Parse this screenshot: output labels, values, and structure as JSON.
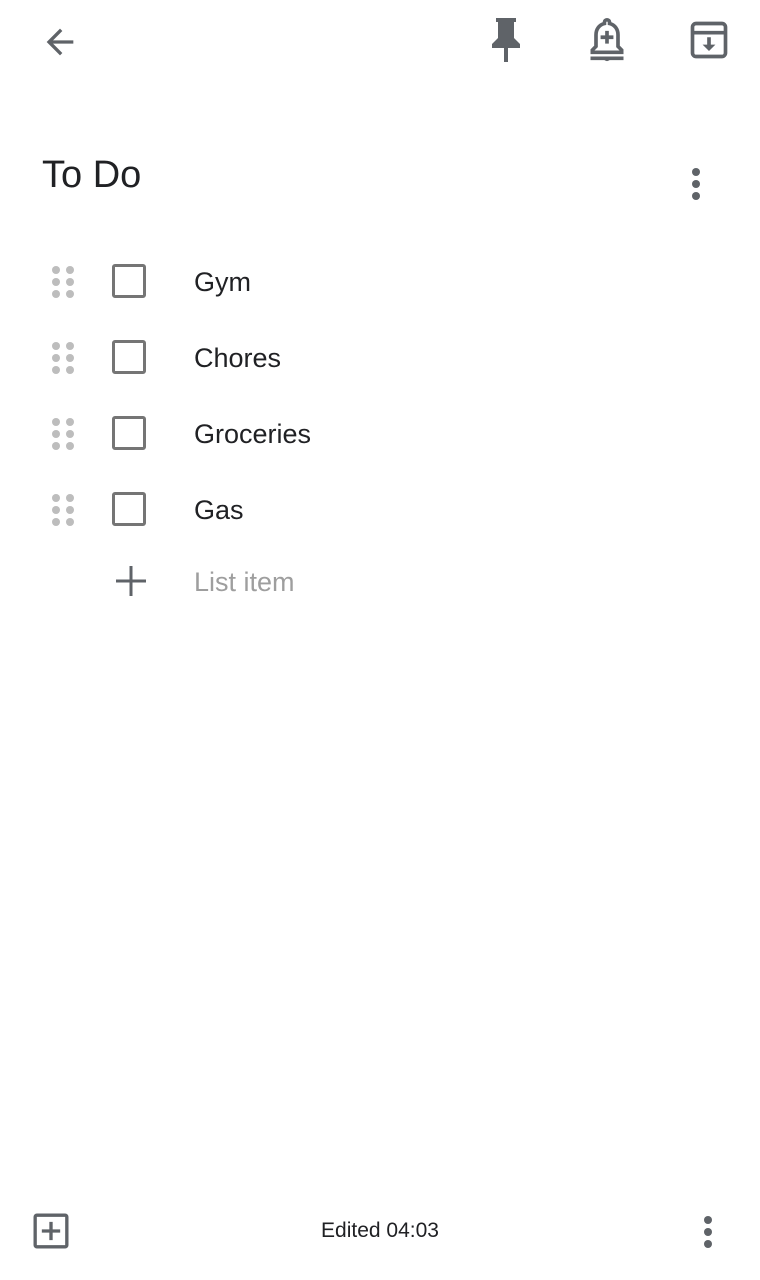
{
  "toolbar": {
    "back_icon": "arrow-back-icon",
    "pin_icon": "pin-icon",
    "reminder_icon": "add-alert-icon",
    "archive_icon": "archive-icon"
  },
  "note": {
    "title": "To Do",
    "more_icon": "more-vert-icon",
    "items": [
      {
        "label": "Gym",
        "checked": false
      },
      {
        "label": "Chores",
        "checked": false
      },
      {
        "label": "Groceries",
        "checked": false
      },
      {
        "label": "Gas",
        "checked": false
      }
    ],
    "add_item_placeholder": "List item"
  },
  "bottom_bar": {
    "add_icon": "add-box-icon",
    "status": "Edited 04:03",
    "more_icon": "more-vert-icon"
  },
  "colors": {
    "icon": "#5f6368",
    "text": "#202124",
    "placeholder": "#9e9e9e",
    "checkbox_border": "#757575",
    "drag_handle": "#bdbdbd"
  }
}
